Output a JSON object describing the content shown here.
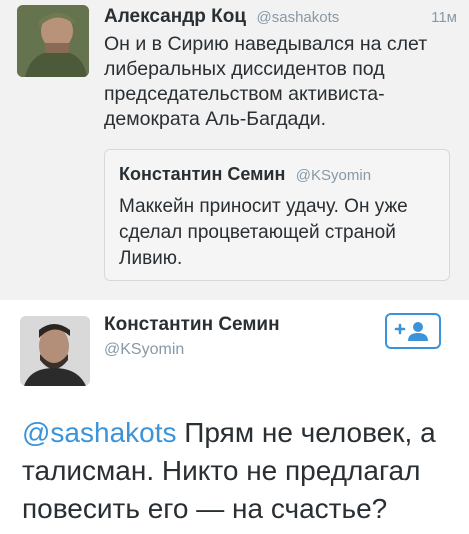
{
  "tweet1": {
    "author_name": "Александр Коц",
    "author_handle": "@sashakots",
    "time": "11м",
    "text": "Он и в Сирию наведывался на слет либеральных диссидентов под председательством активиста-демократа Аль-Багдади.",
    "quoted": {
      "author_name": "Константин Семин",
      "author_handle": "@KSyomin",
      "text": "Маккейн приносит удачу. Он уже сделал процветающей страной Ливию."
    }
  },
  "tweet2": {
    "author_name": "Константин Семин",
    "author_handle": "@KSyomin",
    "follow_icon": "add-user-icon",
    "mention": "@sashakots",
    "text": " Прям не человек, а талисман. Никто не предлагал повесить его — на счастье?"
  },
  "colors": {
    "link": "#3b94d9",
    "secondary_text": "#8899a6",
    "primary_text": "#292f33"
  }
}
